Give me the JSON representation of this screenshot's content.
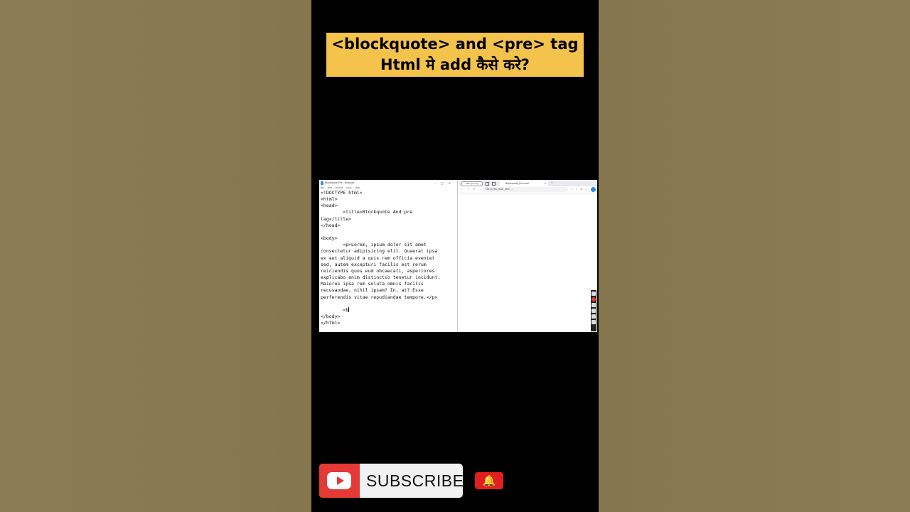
{
  "title": {
    "line1": "<blockquote> and <pre> tag",
    "line2": "Html मे add कैसे करे?"
  },
  "notepad": {
    "window_title": "Blockquote_Pre - Notepad",
    "menu": [
      "File",
      "Edit",
      "Format",
      "View",
      "Help"
    ],
    "code_lines": [
      "<!DOCTYPE html>",
      "<html>",
      "<head>",
      "        <title>Blockquote And pre",
      "tag</title>",
      "</head>",
      "",
      "<body>",
      "        <p>Lorem, ipsum dolor sit amet",
      "consectetur adipisicing elit. Quaerat ipsa",
      "ex aut aliquid a quis rem officia eveniet",
      "sed, autem excepturi facilis est rerum",
      "reiciendis quos eum obcaecati, asperiores",
      "explicabo enim distinctio tenetur incidunt.",
      "Maiores ipsa rem soluta omnis facilis",
      "recusandae, nihil ipsam? In, at? Esse",
      "perferendis vitae repudiandae tempore.</p>",
      "",
      "        <b",
      "</body>",
      "</html>"
    ]
  },
  "browser": {
    "profile_label": "Not syncing",
    "tab_title": "Blockquote_Pre.html",
    "url_prefix": "File",
    "url": "D:/You_tube_html_..."
  },
  "subscribe": {
    "label": "SUBSCRIBE"
  },
  "colors": {
    "title_bg": "#f4c34c",
    "youtube_red": "#e53935",
    "bell_red": "#e02020"
  },
  "icons": [
    "youtube-play-icon",
    "bell-icon"
  ]
}
